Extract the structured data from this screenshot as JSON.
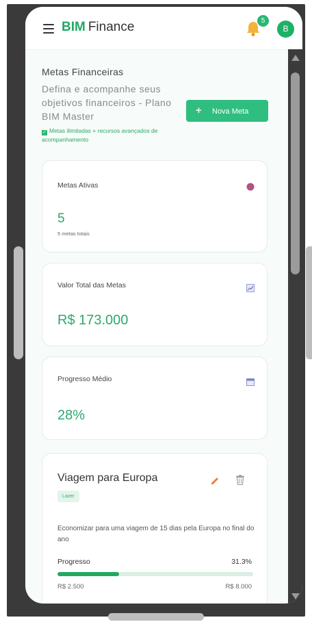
{
  "header": {
    "brand_bold": "BIM",
    "brand_rest": "Finance",
    "notification_count": "5",
    "avatar_initial": "B"
  },
  "page": {
    "title": "Metas Financeiras",
    "description": "Defina e acompanhe seus objetivos financeiros - Plano BIM Master",
    "plan_note": "Metas ilimitadas + recursos avançados de acompanhamento",
    "new_goal_label": "Nova Meta"
  },
  "stats": [
    {
      "label": "Metas Ativas",
      "value": "5",
      "sub": "5 metas totais",
      "icon": "target-icon"
    },
    {
      "label": "Valor Total das Metas",
      "value": "R$ 173.000",
      "icon": "chart-icon"
    },
    {
      "label": "Progresso Médio",
      "value": "28%",
      "icon": "calendar-icon"
    }
  ],
  "goal": {
    "title": "Viagem para Europa",
    "tag": "Lazer",
    "description": "Economizar para uma viagem de 15 dias pela Europa no final do ano",
    "progress_label": "Progresso",
    "progress_pct": "31.3%",
    "progress_fraction": 0.313,
    "current_amount": "R$ 2.500",
    "target_amount": "R$ 8.000"
  },
  "colors": {
    "accent": "#2cb673",
    "value_text": "#2ca86e",
    "button": "#2fbe80"
  }
}
